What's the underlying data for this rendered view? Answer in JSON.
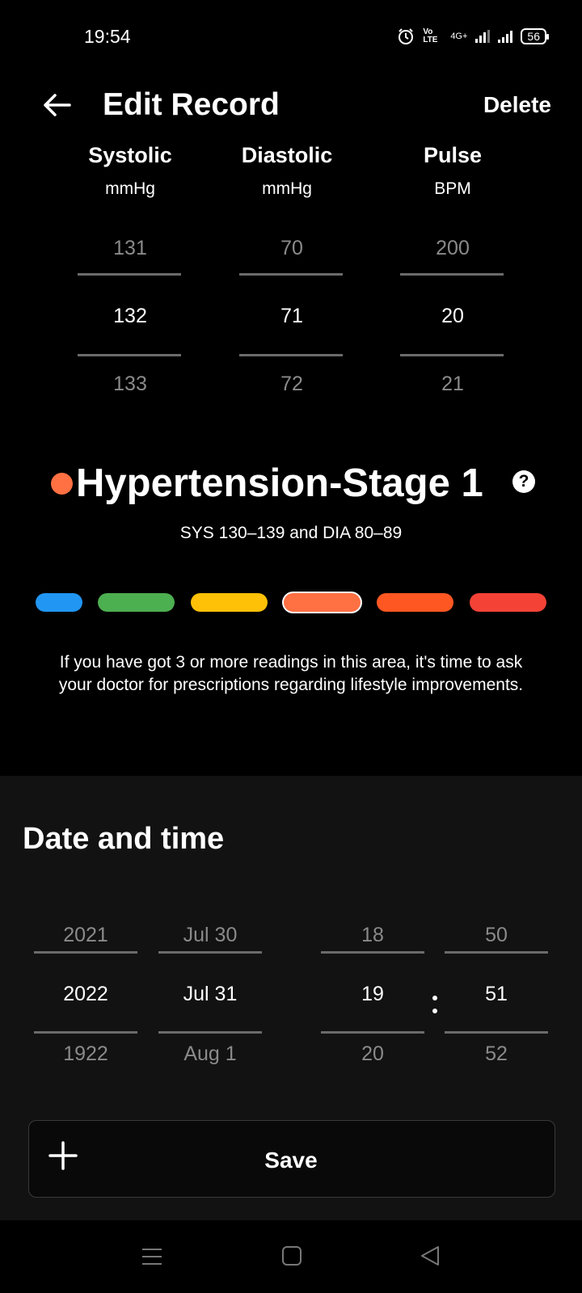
{
  "status": {
    "time": "19:54",
    "network": "4G+",
    "volte": "Vo LTE",
    "battery": "56"
  },
  "header": {
    "title": "Edit Record",
    "delete_label": "Delete"
  },
  "pickers": [
    {
      "label": "Systolic",
      "unit": "mmHg",
      "prev": "131",
      "current": "132",
      "next": "133"
    },
    {
      "label": "Diastolic",
      "unit": "mmHg",
      "prev": "70",
      "current": "71",
      "next": "72"
    },
    {
      "label": "Pulse",
      "unit": "BPM",
      "prev": "200",
      "current": "20",
      "next": "21"
    }
  ],
  "stage": {
    "title": "Hypertension-Stage 1",
    "range": "SYS 130–139 and DIA 80–89",
    "color": "#ff7043",
    "scale_colors": [
      "#2196f3",
      "#4caf50",
      "#ffc107",
      "#ff7043",
      "#ff5722",
      "#f44336"
    ],
    "selected_index": 3,
    "advice": "If you have got 3 or more readings in this area, it's time to ask your doctor for prescriptions regarding lifestyle improvements."
  },
  "datetime": {
    "title": "Date and time",
    "year": {
      "prev": "2021",
      "current": "2022",
      "next": "1922"
    },
    "day": {
      "prev": "Jul 30",
      "current": "Jul 31",
      "next": "Aug 1"
    },
    "hour": {
      "prev": "18",
      "current": "19",
      "next": "20"
    },
    "minute": {
      "prev": "50",
      "current": "51",
      "next": "52"
    }
  },
  "save": {
    "label": "Save"
  },
  "icons": [
    "back-arrow-icon",
    "help-icon",
    "plus-icon",
    "menu-icon",
    "home-icon",
    "back-icon",
    "alarm-icon",
    "signal-icon",
    "battery-icon"
  ]
}
